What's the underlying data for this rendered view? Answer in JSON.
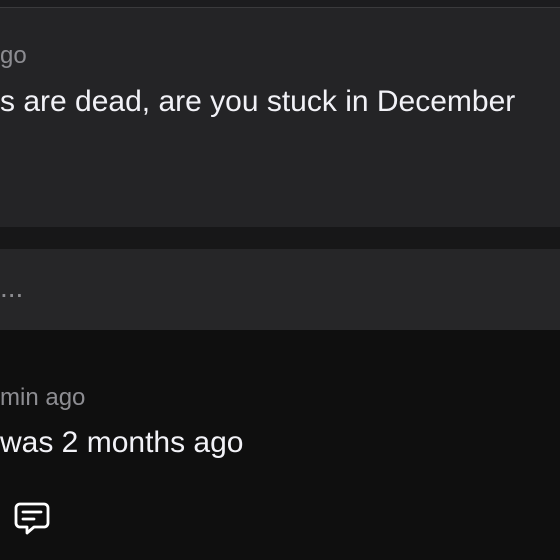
{
  "thread": {
    "first_comment": {
      "meta": "go",
      "text": "s are dead, are you stuck in December"
    },
    "reply_input": {
      "placeholder": "..."
    },
    "second_comment": {
      "meta": "min ago",
      "text": "was 2 months ago",
      "reply_icon": "message-icon"
    }
  }
}
